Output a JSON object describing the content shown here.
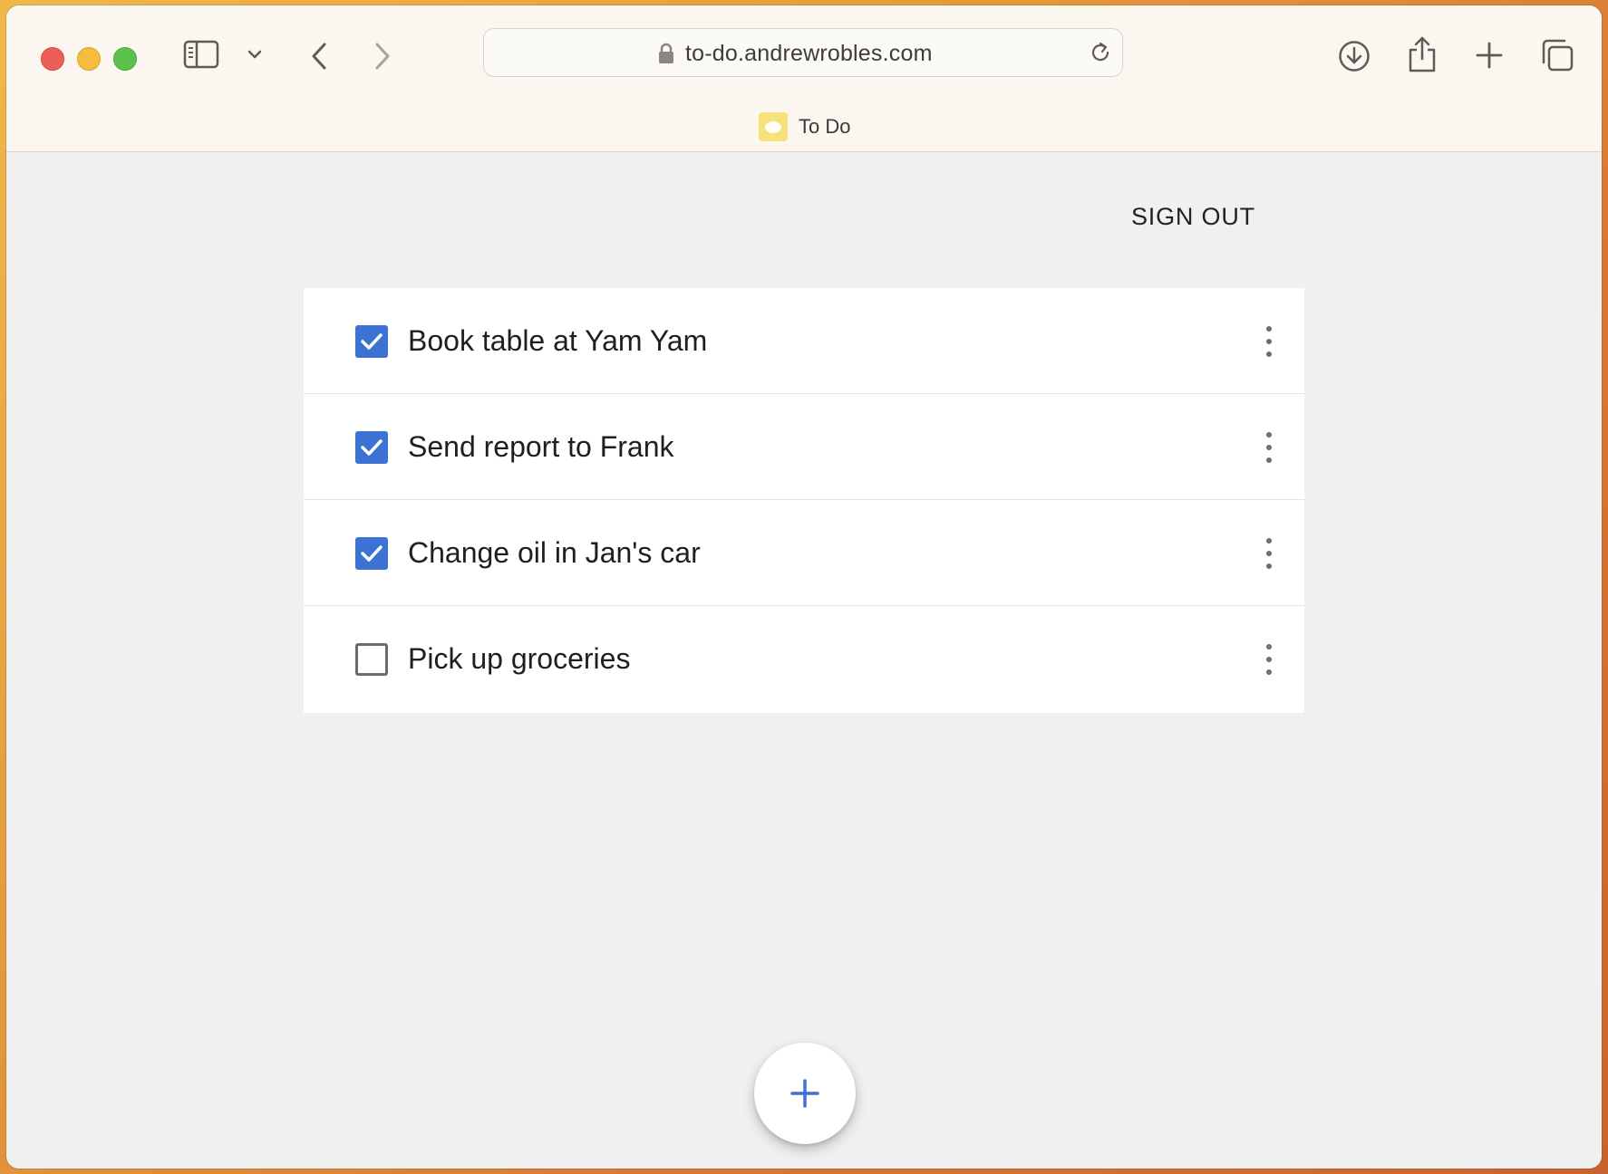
{
  "browser": {
    "address": "to-do.andrewrobles.com",
    "tab_title": "To Do"
  },
  "header": {
    "sign_out_label": "SIGN OUT"
  },
  "todos": [
    {
      "text": "Book table at Yam Yam",
      "checked": true
    },
    {
      "text": "Send report to Frank",
      "checked": true
    },
    {
      "text": "Change oil in Jan's car",
      "checked": true
    },
    {
      "text": "Pick up groceries",
      "checked": false
    }
  ],
  "colors": {
    "accent": "#3b72d4",
    "background": "#f0f0f0"
  },
  "icons": {
    "fab": "plus-icon",
    "row_menu": "more-vert-icon"
  }
}
